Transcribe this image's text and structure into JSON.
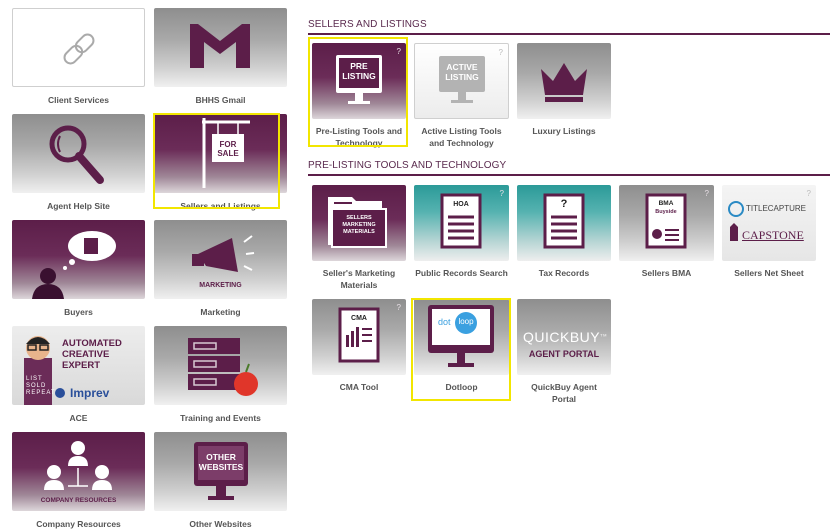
{
  "left_tiles": [
    {
      "label": "Client Services"
    },
    {
      "label": "BHHS Gmail"
    },
    {
      "label": "Agent Help Site"
    },
    {
      "label": "Sellers and Listings",
      "art": "FOR SALE"
    },
    {
      "label": "Buyers"
    },
    {
      "label": "Marketing",
      "art": "MARKETING"
    },
    {
      "label": "ACE",
      "art_lines": [
        "AUTOMATED",
        "CREATIVE",
        "EXPERT"
      ],
      "art_brand": "Imprev",
      "art_badge": [
        "LIST",
        "SOLD",
        "REPEAT"
      ]
    },
    {
      "label": "Training and Events"
    },
    {
      "label": "Company Resources",
      "art": "COMPANY RESOURCES"
    },
    {
      "label": "Other Websites",
      "art_lines": [
        "OTHER",
        "WEBSITES"
      ]
    }
  ],
  "sections": {
    "sellers_listings": {
      "title": "SELLERS AND LISTINGS",
      "tiles": [
        {
          "label_lines": [
            "Pre-Listing Tools and",
            "Technology"
          ],
          "art_lines": [
            "PRE",
            "LISTING"
          ]
        },
        {
          "label_lines": [
            "Active Listing Tools",
            "and Technology"
          ],
          "art_lines": [
            "ACTIVE",
            "LISTING"
          ]
        },
        {
          "label_lines": [
            "Luxury Listings"
          ]
        }
      ]
    },
    "prelisting": {
      "title": "PRE-LISTING TOOLS AND TECHNOLOGY",
      "tiles": [
        {
          "label_lines": [
            "Seller's Marketing",
            "Materials"
          ],
          "art_lines": [
            "SELLERS",
            "MARKETING",
            "MATERIALS"
          ]
        },
        {
          "label_lines": [
            "Public Records Search"
          ],
          "art": "HOA"
        },
        {
          "label_lines": [
            "Tax Records"
          ],
          "art": "?"
        },
        {
          "label_lines": [
            "Sellers BMA"
          ],
          "art": "BMA",
          "art_sub": "Buyside"
        },
        {
          "label_lines": [
            "Sellers Net Sheet"
          ],
          "art_lines": [
            "TITLECAPTURE",
            "CAPSTONE"
          ]
        },
        {
          "label_lines": [
            "CMA Tool"
          ],
          "art": "CMA"
        },
        {
          "label_lines": [
            "Dotloop"
          ],
          "art_lines": [
            "dot",
            "loop"
          ]
        },
        {
          "label_lines": [
            "QuickBuy Agent",
            "Portal"
          ],
          "art_lines": [
            "QUICKBUY",
            "AGENT PORTAL"
          ],
          "art_tm": "TM"
        }
      ]
    }
  },
  "help_marker": "?",
  "colors": {
    "plum": "#5c1e49",
    "highlight": "#f2e600",
    "teal": "#2b9a98",
    "caption": "#555555"
  }
}
